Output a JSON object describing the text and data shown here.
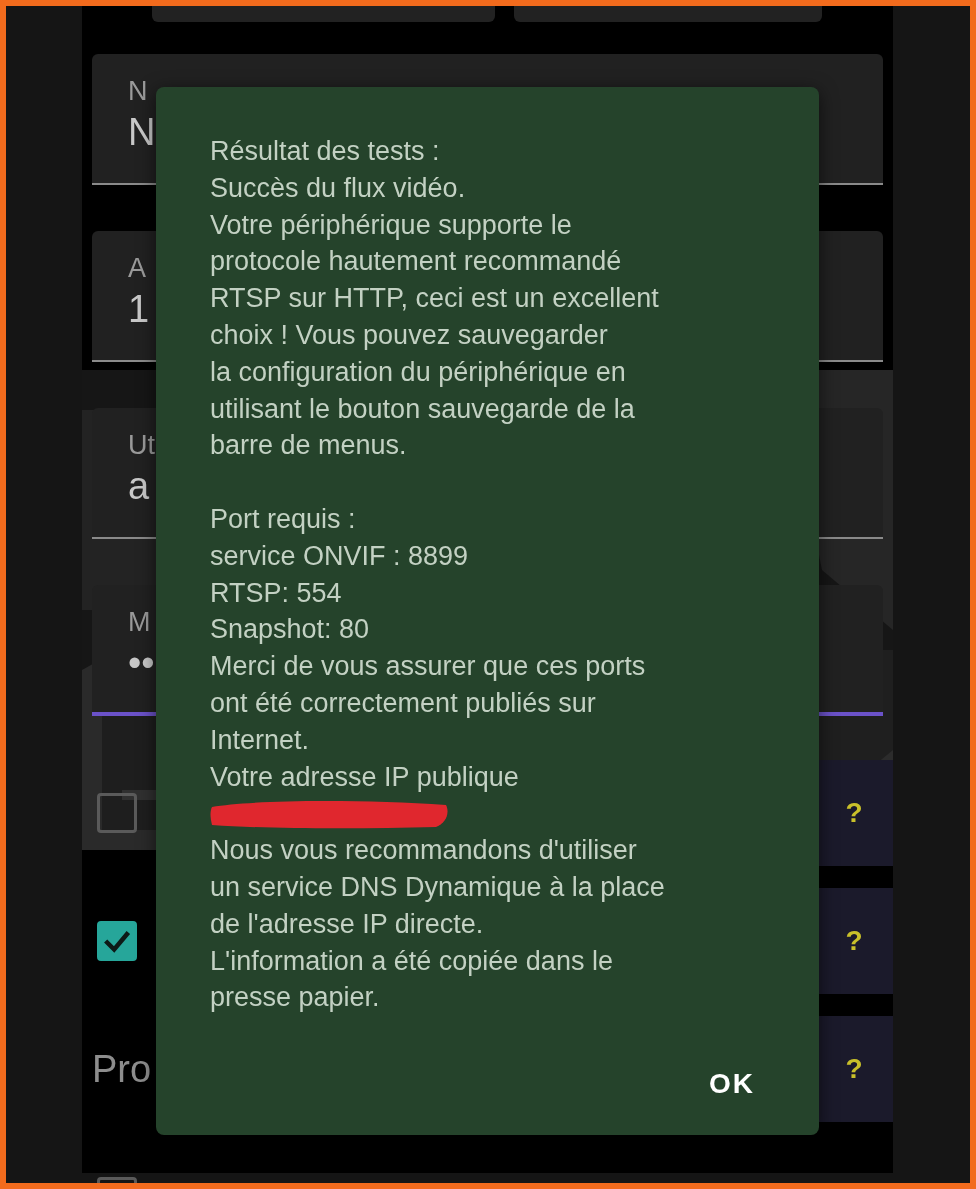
{
  "form": {
    "fields": [
      {
        "label": "N",
        "value": "N",
        "focused": false
      },
      {
        "label": "A",
        "value": "1",
        "focused": false
      },
      {
        "label": "Ut",
        "value": "a",
        "focused": false
      },
      {
        "label": "M",
        "value": "••",
        "focused": true
      }
    ],
    "options": [
      {
        "kind": "checkbox",
        "checked": false,
        "help": "?"
      },
      {
        "kind": "checkbox",
        "checked": true,
        "help": "?"
      },
      {
        "kind": "heading",
        "label": "Pro",
        "help": "?"
      },
      {
        "kind": "checkbox",
        "checked": false
      }
    ]
  },
  "dialog": {
    "lines": [
      {
        "kind": "text",
        "text": "Résultat des tests :"
      },
      {
        "kind": "text",
        "text": "Succès du flux vidéo."
      },
      {
        "kind": "text",
        "text": "Votre périphérique supporte le"
      },
      {
        "kind": "text",
        "text": "protocole hautement recommandé"
      },
      {
        "kind": "text",
        "text": "RTSP sur HTTP, ceci est un excellent"
      },
      {
        "kind": "text",
        "text": "choix ! Vous pouvez sauvegarder"
      },
      {
        "kind": "text",
        "text": "la configuration du périphérique en"
      },
      {
        "kind": "text",
        "text": "utilisant le bouton sauvegarde de la"
      },
      {
        "kind": "text",
        "text": "barre de menus."
      },
      {
        "kind": "gap"
      },
      {
        "kind": "text",
        "text": "Port requis :"
      },
      {
        "kind": "text",
        "text": "service ONVIF : 8899"
      },
      {
        "kind": "text",
        "text": "RTSP: 554"
      },
      {
        "kind": "text",
        "text": "Snapshot: 80"
      },
      {
        "kind": "text",
        "text": "Merci de vous assurer que ces ports"
      },
      {
        "kind": "text",
        "text": "ont été correctement publiés sur"
      },
      {
        "kind": "text",
        "text": "Internet."
      },
      {
        "kind": "text",
        "text": "Votre adresse IP publique"
      },
      {
        "kind": "redacted"
      },
      {
        "kind": "text",
        "text": "Nous vous recommandons d'utiliser"
      },
      {
        "kind": "text",
        "text": "un service DNS Dynamique à la place"
      },
      {
        "kind": "text",
        "text": "de l'adresse IP directe."
      },
      {
        "kind": "text",
        "text": "L'information a été copiée dans le"
      },
      {
        "kind": "text",
        "text": "presse papier."
      }
    ],
    "button": "OK"
  }
}
